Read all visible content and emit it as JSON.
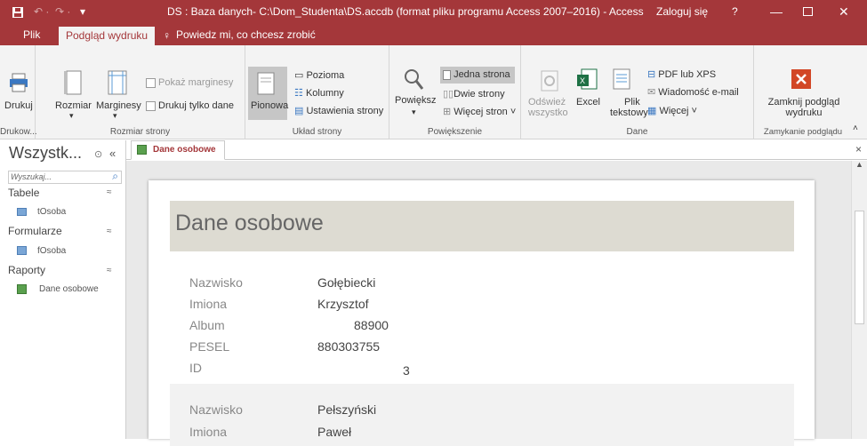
{
  "titlebar": {
    "title": "DS : Baza danych- C:\\Dom_Studenta\\DS.accdb (format pliku programu Access 2007–2016) - Access",
    "login": "Zaloguj się",
    "help": "?"
  },
  "tabs": {
    "file": "Plik",
    "preview": "Podgląd wydruku",
    "tell": "Powiedz mi, co chcesz zrobić"
  },
  "ribbon": {
    "print": "Drukuj",
    "print_group": "Drukow...",
    "size": "Rozmiar",
    "margins": "Marginesy",
    "show_margins": "Pokaż marginesy",
    "print_data_only": "Drukuj tylko dane",
    "size_group": "Rozmiar strony",
    "portrait": "Pionowa",
    "landscape": "Pozioma",
    "columns": "Kolumny",
    "page_setup": "Ustawienia strony",
    "layout_group": "Układ strony",
    "zoom": "Powiększ",
    "one_page": "Jedna strona",
    "two_pages": "Dwie strony",
    "more_pages": "Więcej stron ˅",
    "zoom_group": "Powiększenie",
    "refresh1": "Odśwież",
    "refresh2": "wszystko",
    "excel": "Excel",
    "textfile1": "Plik",
    "textfile2": "tekstowy",
    "pdf": "PDF lub XPS",
    "email": "Wiadomość e-mail",
    "more": "Więcej ˅",
    "data_group": "Dane",
    "close1": "Zamknij podgląd",
    "close2": "wydruku",
    "close_group": "Zamykanie podglądu"
  },
  "nav": {
    "title": "Wszystk...",
    "search_placeholder": "Wyszukaj...",
    "sections": [
      {
        "label": "Tabele",
        "item": "tOsoba"
      },
      {
        "label": "Formularze",
        "item": "fOsoba"
      },
      {
        "label": "Raporty",
        "item": "Dane osobowe"
      }
    ]
  },
  "doc": {
    "tab": "Dane osobowe",
    "report_title": "Dane osobowe",
    "records": [
      {
        "nazwisko_label": "Nazwisko",
        "nazwisko": "Gołębiecki",
        "imiona_label": "Imiona",
        "imiona": "Krzysztof",
        "album_label": "Album",
        "album": "88900",
        "pesel_label": "PESEL",
        "pesel": "880303755",
        "id_label": "ID",
        "id": "3"
      },
      {
        "nazwisko_label": "Nazwisko",
        "nazwisko": "Pełszyński",
        "imiona_label": "Imiona",
        "imiona": "Paweł"
      }
    ]
  }
}
